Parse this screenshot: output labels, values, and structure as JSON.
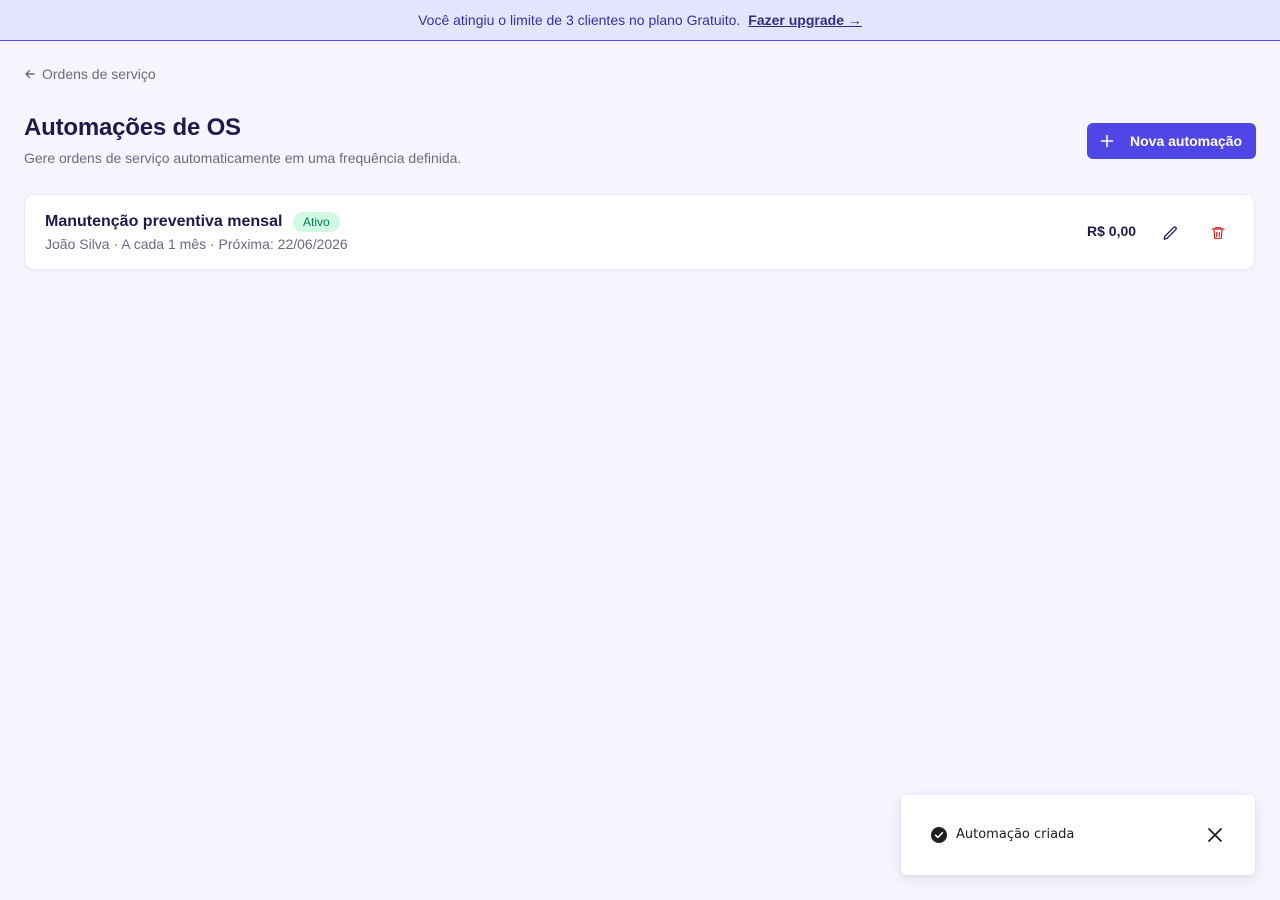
{
  "banner": {
    "message": "Você atingiu o limite de 3 clientes no plano Gratuito.",
    "upgrade_link": "Fazer upgrade →"
  },
  "nav": {
    "back_label": "Ordens de serviço",
    "back_icon": "arrow-left-icon"
  },
  "header": {
    "title": "Automações de OS",
    "subtitle": "Gere ordens de serviço automaticamente em uma frequência definida.",
    "new_button_label": "Nova automação",
    "new_button_icon": "plus-icon"
  },
  "automations": [
    {
      "name": "Manutenção preventiva mensal",
      "status": "Ativo",
      "meta": "João Silva · A cada 1 mês · Próxima: 22/06/2026",
      "price": "R$ 0,00",
      "edit_icon": "pencil-icon",
      "delete_icon": "trash-icon"
    }
  ],
  "toast": {
    "message": "Automação criada",
    "icon": "check-circle-icon",
    "close_icon": "close-icon"
  },
  "colors": {
    "accent": "#4f46e5",
    "banner_bg": "#e3e5fc",
    "page_bg": "#f6f5fd",
    "status_active_bg": "#d1fae5",
    "status_active_text": "#047857",
    "danger": "#dc2626"
  }
}
